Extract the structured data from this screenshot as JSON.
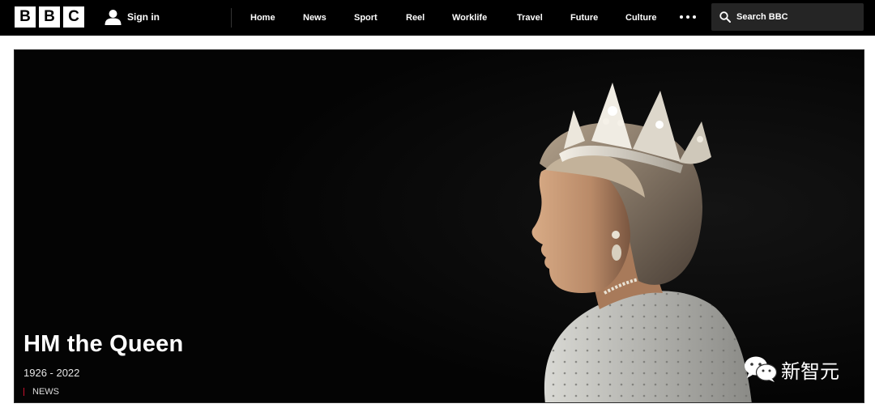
{
  "header": {
    "logo": [
      "B",
      "B",
      "C"
    ],
    "signin_label": "Sign in",
    "nav": [
      "Home",
      "News",
      "Sport",
      "Reel",
      "Worklife",
      "Travel",
      "Future",
      "Culture"
    ],
    "more_icon": "more-dots-icon",
    "search_placeholder": "Search BBC"
  },
  "hero": {
    "title": "HM the Queen",
    "dates": "1926 - 2022",
    "tag": "NEWS",
    "tag_color": "#c8102e",
    "image": "portrait of Queen Elizabeth II in profile wearing a diamond crown"
  },
  "watermark": {
    "text": "新智元",
    "icon": "wechat-icon"
  },
  "colors": {
    "nav_bg": "#000000",
    "search_bg": "#252525",
    "hero_bg": "#050505"
  }
}
